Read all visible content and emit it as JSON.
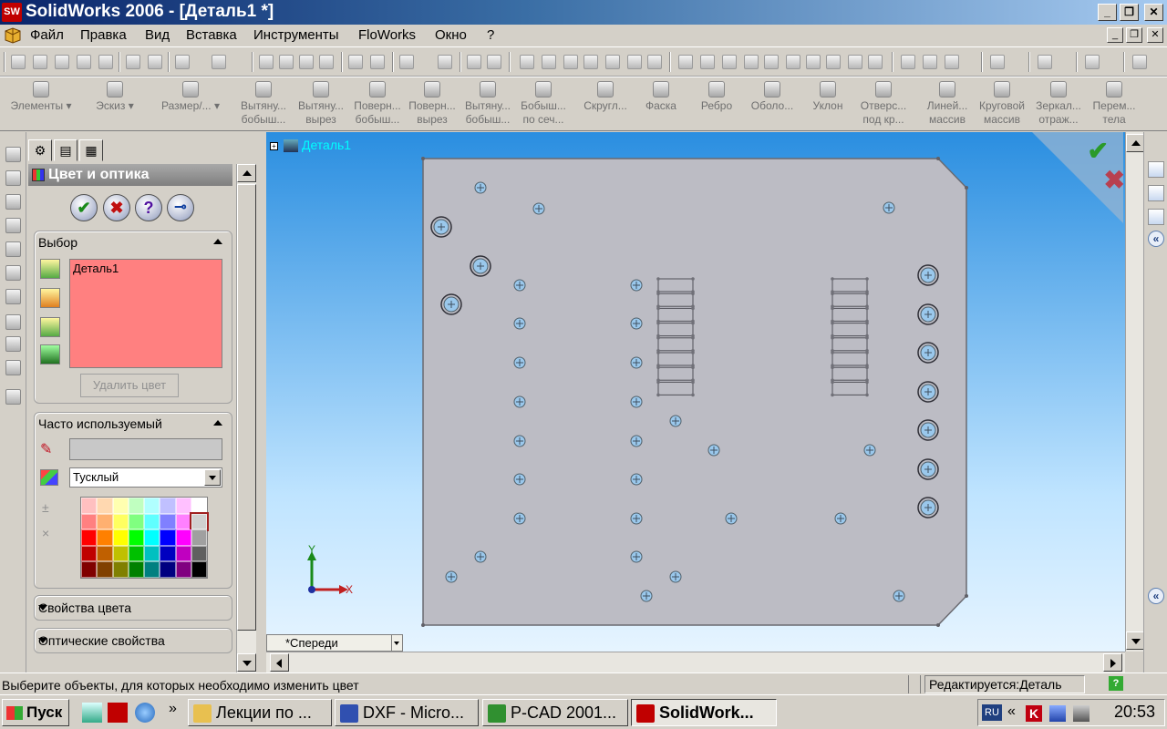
{
  "window": {
    "app_icon_text": "SW",
    "title": "SolidWorks 2006 - [Деталь1 *]",
    "minimize": "_",
    "restore": "❐",
    "close": "✕"
  },
  "menu": {
    "items": [
      "Файл",
      "Правка",
      "Вид",
      "Вставка",
      "Инструменты",
      "FloWorks",
      "Окно",
      "?"
    ]
  },
  "features_toolbar": {
    "items": [
      {
        "line1": "Элементы",
        "line2": ""
      },
      {
        "line1": "Эскиз",
        "line2": ""
      },
      {
        "line1": "Размер/...",
        "line2": ""
      },
      {
        "line1": "Вытяну...",
        "line2": "бобыш..."
      },
      {
        "line1": "Вытяну...",
        "line2": "вырез"
      },
      {
        "line1": "Поверн...",
        "line2": "бобыш..."
      },
      {
        "line1": "Поверн...",
        "line2": "вырез"
      },
      {
        "line1": "Вытяну...",
        "line2": "бобыш..."
      },
      {
        "line1": "Бобыш...",
        "line2": "по сеч..."
      },
      {
        "line1": "Скругл...",
        "line2": ""
      },
      {
        "line1": "Фаска",
        "line2": ""
      },
      {
        "line1": "Ребро",
        "line2": ""
      },
      {
        "line1": "Оболо...",
        "line2": ""
      },
      {
        "line1": "Уклон",
        "line2": ""
      },
      {
        "line1": "Отверс...",
        "line2": "под кр..."
      },
      {
        "line1": "Линей...",
        "line2": "массив"
      },
      {
        "line1": "Круговой",
        "line2": "массив"
      },
      {
        "line1": "Зеркал...",
        "line2": "отраж..."
      },
      {
        "line1": "Перем...",
        "line2": "тела"
      }
    ]
  },
  "property_manager": {
    "title": "Цвет и оптика",
    "ok": "✔",
    "cancel": "✖",
    "help": "?",
    "pin": "⊸",
    "selection": {
      "header": "Выбор",
      "items": [
        "Деталь1"
      ],
      "remove_color": "Удалить цвет"
    },
    "favorites": {
      "header": "Часто используемый",
      "finish_value": "Тусклый",
      "palette": [
        "#ffc0c0",
        "#ffd8b0",
        "#ffffb0",
        "#c0ffc0",
        "#b0ffff",
        "#c0c0ff",
        "#ffc0ff",
        "#ffffff",
        "#ff8080",
        "#ffb070",
        "#ffff60",
        "#80ff80",
        "#60ffff",
        "#8080ff",
        "#ff80ff",
        "#d0d0d0",
        "#ff0000",
        "#ff8000",
        "#ffff00",
        "#00ff00",
        "#00ffff",
        "#0000ff",
        "#ff00ff",
        "#a0a0a0",
        "#c00000",
        "#c06000",
        "#c0c000",
        "#00c000",
        "#00c0c0",
        "#0000c0",
        "#c000c0",
        "#606060",
        "#800000",
        "#804000",
        "#808000",
        "#008000",
        "#008080",
        "#000080",
        "#800080",
        "#000000"
      ]
    },
    "color_props": "Свойства цвета",
    "optical_props": "Оптические свойства"
  },
  "graphics": {
    "tree_root": "Деталь1",
    "view_name": "*Спереди",
    "ok_corner": "✔",
    "cancel_corner": "✖",
    "triad_y": "Y",
    "triad_x": "X"
  },
  "status": {
    "text": "Выберите объекты, для которых необходимо изменить цвет",
    "mode": "Редактируется:Деталь",
    "help": "?"
  },
  "taskbar": {
    "start": "Пуск",
    "quick_overflow": "»",
    "tasks": [
      {
        "label": "Лекции по ...",
        "color": "#e8c050"
      },
      {
        "label": "DXF - Micro...",
        "color": "#3050b0"
      },
      {
        "label": "P-CAD 2001...",
        "color": "#309030"
      },
      {
        "label": "SolidWork...",
        "color": "#c00000"
      }
    ],
    "lang": "RU",
    "tray_overflow": "«",
    "clock": "20:53"
  }
}
